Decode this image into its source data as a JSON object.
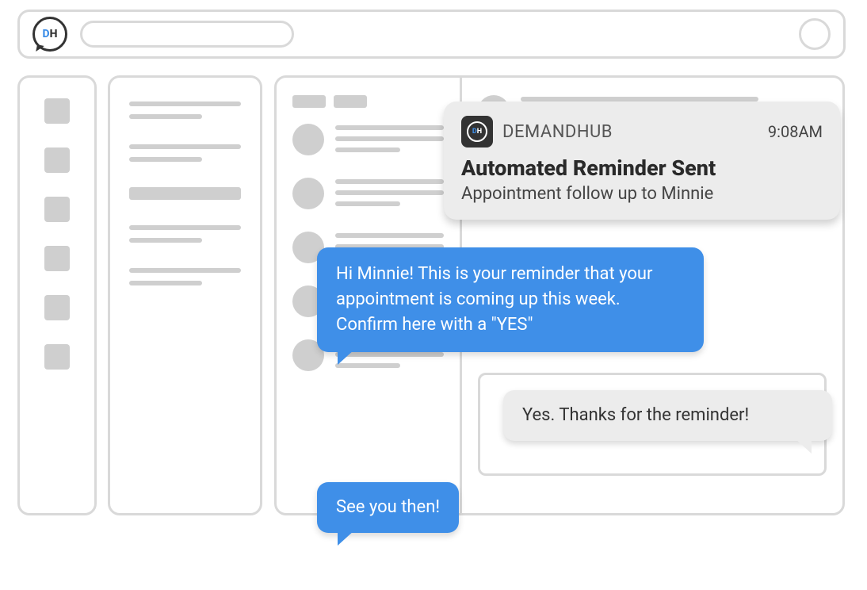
{
  "app": {
    "logo_letters": {
      "d": "D",
      "h": "H"
    },
    "name": "DEMANDHUB"
  },
  "notification": {
    "app_name": "DEMANDHUB",
    "time": "9:08AM",
    "title": "Automated Reminder Sent",
    "subtitle": "Appointment follow up to Minnie"
  },
  "messages": {
    "outgoing1": "Hi Minnie! This is your reminder that your appointment is coming up this week. Confirm here with a \"YES\"",
    "incoming1": "Yes. Thanks for the reminder!",
    "outgoing2": "See you then!"
  }
}
